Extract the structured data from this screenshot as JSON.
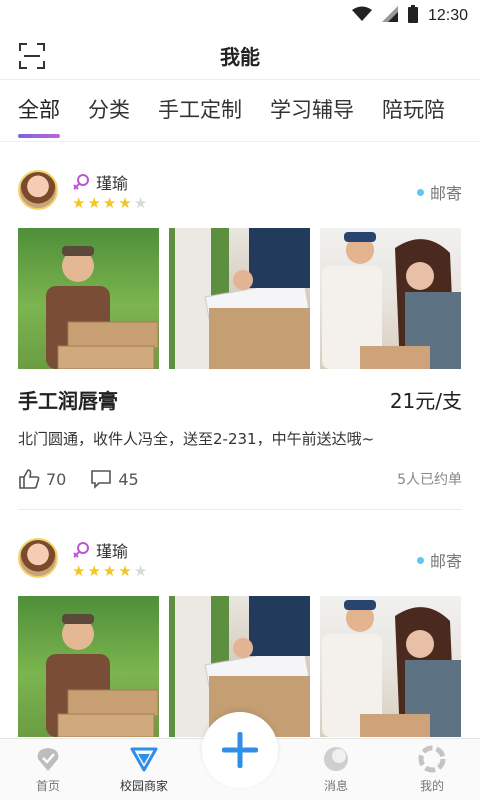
{
  "status_bar": {
    "time": "12:30"
  },
  "header": {
    "title": "我能"
  },
  "tabs": [
    {
      "label": "全部"
    },
    {
      "label": "分类"
    },
    {
      "label": "手工定制"
    },
    {
      "label": "学习辅导"
    },
    {
      "label": "陪玩陪"
    }
  ],
  "cards": [
    {
      "username": "瑾瑜",
      "rating": 4,
      "rating_max": 5,
      "delivery": "邮寄",
      "item_title": "手工润唇膏",
      "price": "21元/支",
      "description": "北门圆通，收件人冯全，送至2-231，中午前送达哦~",
      "likes": "70",
      "comments": "45",
      "booked": "5人已约单"
    },
    {
      "username": "瑾瑜",
      "rating": 4,
      "rating_max": 5,
      "delivery": "邮寄"
    }
  ],
  "bottom_nav": [
    {
      "label": "首页"
    },
    {
      "label": "校园商家"
    },
    {
      "label": "消息"
    },
    {
      "label": "我的"
    }
  ],
  "colors": {
    "accent_blue": "#2f8ee8",
    "tab_underline": "#8a62dc",
    "star": "#f3c623",
    "delivery_dot": "#5ec8f0"
  }
}
